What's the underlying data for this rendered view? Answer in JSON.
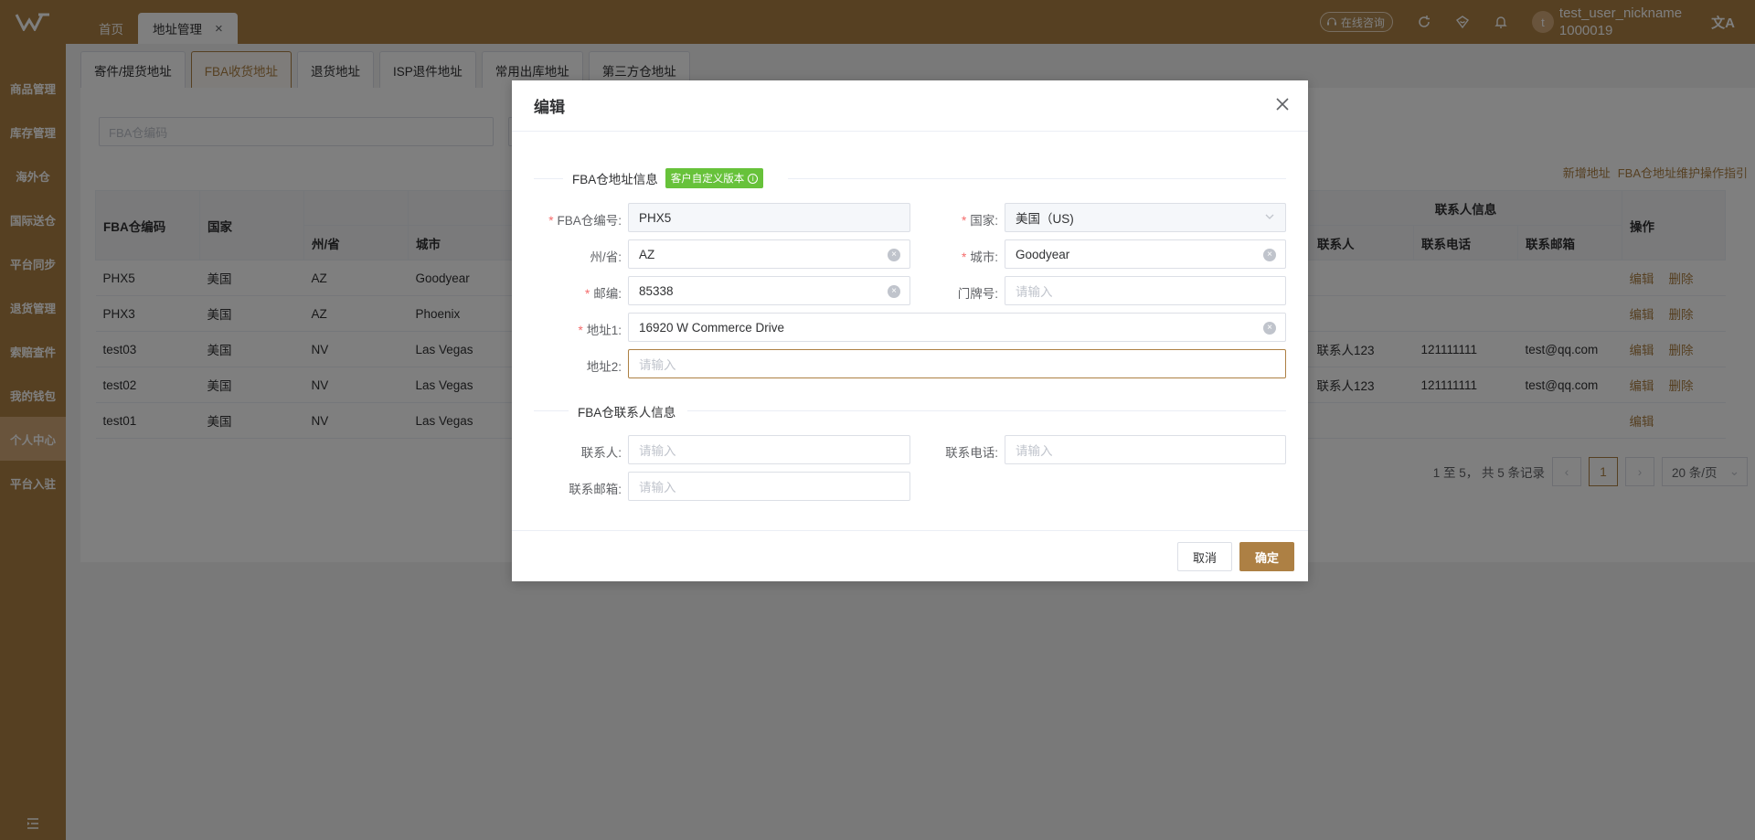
{
  "header": {
    "tabs": [
      {
        "label": "首页"
      },
      {
        "label": "地址管理"
      }
    ],
    "consult_label": "在线咨询",
    "user": {
      "avatar_letter": "t",
      "nickname": "test_user_nickname",
      "id": "1000019"
    },
    "accent_color": "#ad8044"
  },
  "sidebar": {
    "items": [
      {
        "label": "商品管理"
      },
      {
        "label": "库存管理"
      },
      {
        "label": "海外仓"
      },
      {
        "label": "国际送仓"
      },
      {
        "label": "平台同步"
      },
      {
        "label": "退货管理"
      },
      {
        "label": "索赔查件"
      },
      {
        "label": "我的钱包"
      },
      {
        "label": "个人中心",
        "active": true
      },
      {
        "label": "平台入驻"
      }
    ]
  },
  "subtabs": [
    {
      "label": "寄件/提货地址"
    },
    {
      "label": "FBA收货地址",
      "active": true
    },
    {
      "label": "退货地址"
    },
    {
      "label": "ISP退件地址"
    },
    {
      "label": "常用出库地址"
    },
    {
      "label": "第三方仓地址"
    }
  ],
  "search": {
    "placeholder": "FBA仓编码"
  },
  "links": {
    "add": "新增地址",
    "guide": "FBA仓地址维护操作指引"
  },
  "table": {
    "headers": {
      "code": "FBA仓编码",
      "country": "国家",
      "state": "州/省",
      "city": "城市",
      "contact_group": "联系人信息",
      "contact": "联系人",
      "phone": "联系电话",
      "email": "联系邮箱",
      "ops": "操作"
    },
    "rows": [
      {
        "code": "PHX5",
        "country": "美国",
        "state": "AZ",
        "city": "Goodyear",
        "contact": "",
        "phone": "",
        "email": "",
        "edit": "编辑",
        "del": "删除"
      },
      {
        "code": "PHX3",
        "country": "美国",
        "state": "AZ",
        "city": "Phoenix",
        "contact": "",
        "phone": "",
        "email": "",
        "edit": "编辑",
        "del": "删除"
      },
      {
        "code": "test03",
        "country": "美国",
        "state": "NV",
        "city": "Las Vegas",
        "contact": "联系人123",
        "phone": "121111111",
        "email": "test@qq.com",
        "edit": "编辑",
        "del": "删除"
      },
      {
        "code": "test02",
        "country": "美国",
        "state": "NV",
        "city": "Las Vegas",
        "contact": "联系人123",
        "phone": "121111111",
        "email": "test@qq.com",
        "edit": "编辑",
        "del": "删除"
      },
      {
        "code": "test01",
        "country": "美国",
        "state": "NV",
        "city": "Las Vegas",
        "contact": "",
        "phone": "",
        "email": "",
        "edit": "编辑",
        "del": ""
      }
    ]
  },
  "pagination": {
    "summary": "1 至 5， 共 5 条记录",
    "current": "1",
    "size": "20 条/页"
  },
  "dialog": {
    "title": "编辑",
    "section1": "FBA仓地址信息",
    "badge": "客户自定义版本",
    "fields": {
      "code": {
        "label": "FBA仓编号:",
        "value": "PHX5"
      },
      "country": {
        "label": "国家:",
        "value": "美国（US)"
      },
      "state": {
        "label": "州/省:",
        "value": "AZ"
      },
      "city": {
        "label": "城市:",
        "value": "Goodyear"
      },
      "zip": {
        "label": "邮编:",
        "value": "85338"
      },
      "door": {
        "label": "门牌号:",
        "placeholder": "请输入"
      },
      "addr1": {
        "label": "地址1:",
        "value": "16920 W Commerce Drive"
      },
      "addr2": {
        "label": "地址2:",
        "placeholder": "请输入"
      }
    },
    "section2": "FBA仓联系人信息",
    "contact_fields": {
      "contact": {
        "label": "联系人:",
        "placeholder": "请输入"
      },
      "phone": {
        "label": "联系电话:",
        "placeholder": "请输入"
      },
      "email": {
        "label": "联系邮箱:",
        "placeholder": "请输入"
      }
    },
    "cancel": "取消",
    "ok": "确定"
  }
}
